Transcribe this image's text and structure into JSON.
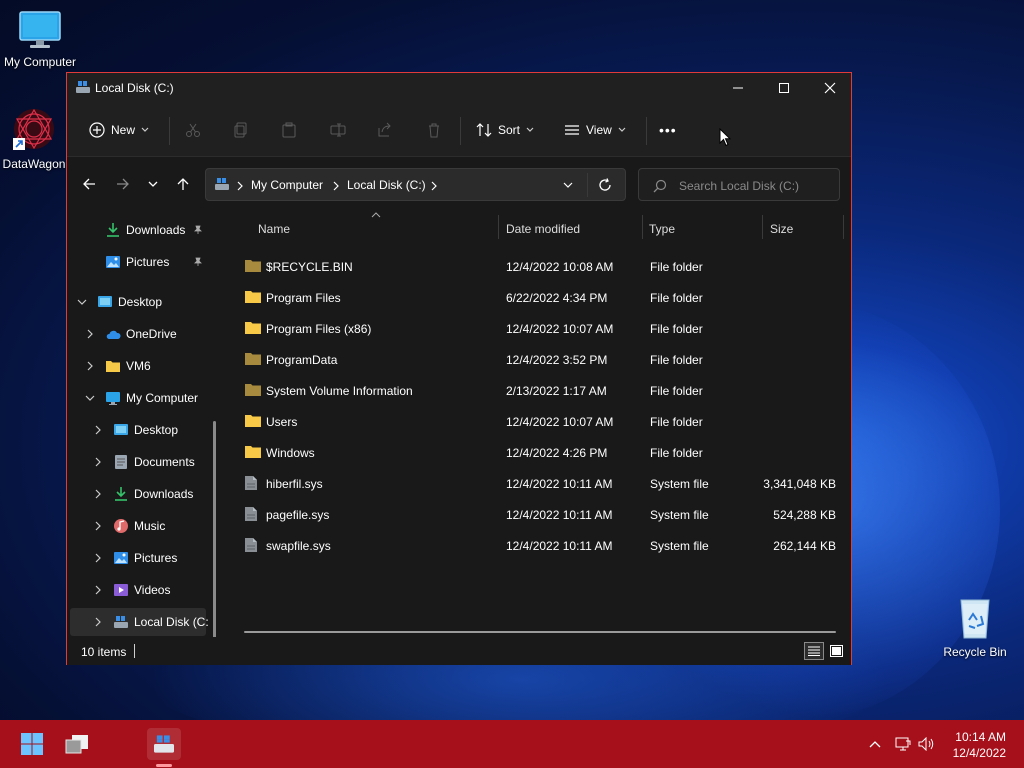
{
  "desktop": {
    "icons": [
      {
        "label": "My Computer",
        "icon": "monitor-icon"
      },
      {
        "label": "DataWagon",
        "icon": "datawagon-logo-icon"
      },
      {
        "label": "Recycle Bin",
        "icon": "recycle-bin-icon"
      }
    ]
  },
  "window": {
    "title": "Local Disk (C:)",
    "toolbar": {
      "new_label": "New",
      "sort_label": "Sort",
      "view_label": "View",
      "more_label": "•••"
    },
    "address": {
      "segments": [
        "My Computer",
        "Local Disk (C:)"
      ]
    },
    "search": {
      "placeholder": "Search Local Disk (C:)"
    },
    "sidebar": {
      "items": [
        {
          "label": "Downloads",
          "icon": "download-icon",
          "pinned": true
        },
        {
          "label": "Pictures",
          "icon": "pictures-icon",
          "pinned": true
        },
        {
          "label": "Desktop",
          "icon": "desktop-icon"
        },
        {
          "label": "OneDrive",
          "icon": "cloud-icon"
        },
        {
          "label": "VM6",
          "icon": "folder-icon"
        },
        {
          "label": "My Computer",
          "icon": "monitor-icon"
        },
        {
          "label": "Desktop",
          "icon": "desktop-icon"
        },
        {
          "label": "Documents",
          "icon": "documents-icon"
        },
        {
          "label": "Downloads",
          "icon": "download-icon"
        },
        {
          "label": "Music",
          "icon": "music-icon"
        },
        {
          "label": "Pictures",
          "icon": "pictures-icon"
        },
        {
          "label": "Videos",
          "icon": "videos-icon"
        },
        {
          "label": "Local Disk (C:",
          "icon": "drive-icon"
        }
      ]
    },
    "columns": {
      "name": "Name",
      "date": "Date modified",
      "type": "Type",
      "size": "Size"
    },
    "files": [
      {
        "name": "$RECYCLE.BIN",
        "date": "12/4/2022 10:08 AM",
        "type": "File folder",
        "size": "",
        "kind": "folder-dim"
      },
      {
        "name": "Program Files",
        "date": "6/22/2022 4:34 PM",
        "type": "File folder",
        "size": "",
        "kind": "folder"
      },
      {
        "name": "Program Files (x86)",
        "date": "12/4/2022 10:07 AM",
        "type": "File folder",
        "size": "",
        "kind": "folder"
      },
      {
        "name": "ProgramData",
        "date": "12/4/2022 3:52 PM",
        "type": "File folder",
        "size": "",
        "kind": "folder-dim"
      },
      {
        "name": "System Volume Information",
        "date": "2/13/2022 1:17 AM",
        "type": "File folder",
        "size": "",
        "kind": "folder-dim"
      },
      {
        "name": "Users",
        "date": "12/4/2022 10:07 AM",
        "type": "File folder",
        "size": "",
        "kind": "folder"
      },
      {
        "name": "Windows",
        "date": "12/4/2022 4:26 PM",
        "type": "File folder",
        "size": "",
        "kind": "folder"
      },
      {
        "name": "hiberfil.sys",
        "date": "12/4/2022 10:11 AM",
        "type": "System file",
        "size": "3,341,048 KB",
        "kind": "file"
      },
      {
        "name": "pagefile.sys",
        "date": "12/4/2022 10:11 AM",
        "type": "System file",
        "size": "524,288 KB",
        "kind": "file"
      },
      {
        "name": "swapfile.sys",
        "date": "12/4/2022 10:11 AM",
        "type": "System file",
        "size": "262,144 KB",
        "kind": "file"
      }
    ],
    "status": {
      "items_count": "10 items"
    }
  },
  "taskbar": {
    "time": "10:14 AM",
    "date": "12/4/2022"
  },
  "colors": {
    "taskbar": "#a5101b",
    "window_border": "#e03a3a",
    "folder": "#f7c948",
    "accent_blue": "#3a8ee6"
  }
}
